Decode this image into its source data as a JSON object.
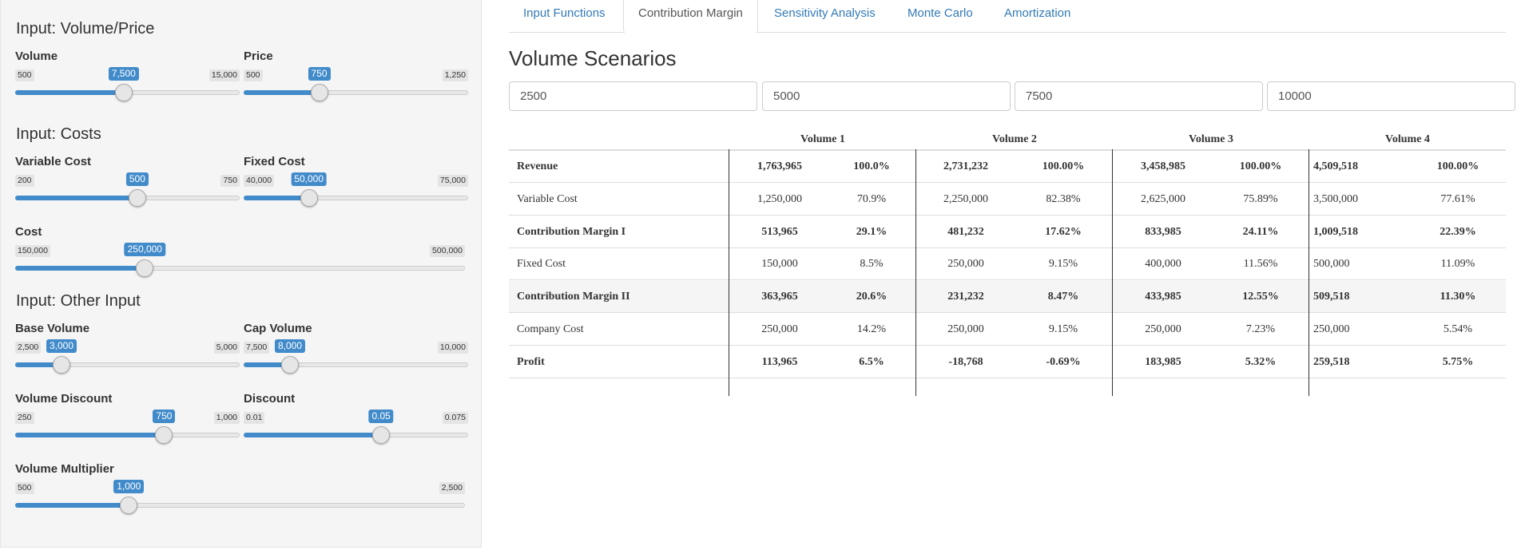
{
  "sidebar": {
    "sections": {
      "volume_price": "Input: Volume/Price",
      "costs": "Input: Costs",
      "other": "Input: Other Input"
    },
    "sliders": {
      "volume": {
        "label": "Volume",
        "min": "500",
        "max": "15,000",
        "value": "7,500",
        "fraction": 0.483
      },
      "price": {
        "label": "Price",
        "min": "500",
        "max": "1,250",
        "value": "750",
        "fraction": 0.333
      },
      "variable_cost": {
        "label": "Variable Cost",
        "min": "200",
        "max": "750",
        "value": "500",
        "fraction": 0.545
      },
      "fixed_cost": {
        "label": "Fixed Cost",
        "min": "40,000",
        "max": "75,000",
        "value": "50,000",
        "fraction": 0.286
      },
      "cost": {
        "label": "Cost",
        "min": "150,000",
        "max": "500,000",
        "value": "250,000",
        "fraction": 0.286
      },
      "base_volume": {
        "label": "Base Volume",
        "min": "2,500",
        "max": "5,000",
        "value": "3,000",
        "fraction": 0.2
      },
      "cap_volume": {
        "label": "Cap Volume",
        "min": "7,500",
        "max": "10,000",
        "value": "8,000",
        "fraction": 0.2
      },
      "volume_discount": {
        "label": "Volume Discount",
        "min": "250",
        "max": "1,000",
        "value": "750",
        "fraction": 0.667
      },
      "discount": {
        "label": "Discount",
        "min": "0.01",
        "max": "0.075",
        "value": "0.05",
        "fraction": 0.615
      },
      "volume_multiplier": {
        "label": "Volume Multiplier",
        "min": "500",
        "max": "2,500",
        "value": "1,000",
        "fraction": 0.25
      }
    }
  },
  "tabs": [
    {
      "label": "Input Functions",
      "active": false
    },
    {
      "label": "Contribution Margin",
      "active": true
    },
    {
      "label": "Sensitivity Analysis",
      "active": false
    },
    {
      "label": "Monte Carlo",
      "active": false
    },
    {
      "label": "Amortization",
      "active": false
    }
  ],
  "main": {
    "title": "Volume Scenarios",
    "scenario_inputs": [
      "2500",
      "5000",
      "7500",
      "10000"
    ],
    "table": {
      "groups": [
        "Volume 1",
        "Volume 2",
        "Volume 3",
        "Volume 4"
      ],
      "rows": [
        {
          "label": "Revenue",
          "bold": true,
          "shaded": false,
          "values": [
            "1,763,965",
            "100.0%",
            "2,731,232",
            "100.00%",
            "3,458,985",
            "100.00%",
            "4,509,518",
            "100.00%"
          ]
        },
        {
          "label": "Variable Cost",
          "bold": false,
          "shaded": false,
          "values": [
            "1,250,000",
            "70.9%",
            "2,250,000",
            "82.38%",
            "2,625,000",
            "75.89%",
            "3,500,000",
            "77.61%"
          ]
        },
        {
          "label": "Contribution Margin I",
          "bold": true,
          "shaded": false,
          "values": [
            "513,965",
            "29.1%",
            "481,232",
            "17.62%",
            "833,985",
            "24.11%",
            "1,009,518",
            "22.39%"
          ]
        },
        {
          "label": "Fixed Cost",
          "bold": false,
          "shaded": false,
          "values": [
            "150,000",
            "8.5%",
            "250,000",
            "9.15%",
            "400,000",
            "11.56%",
            "500,000",
            "11.09%"
          ]
        },
        {
          "label": "Contribution Margin II",
          "bold": true,
          "shaded": true,
          "values": [
            "363,965",
            "20.6%",
            "231,232",
            "8.47%",
            "433,985",
            "12.55%",
            "509,518",
            "11.30%"
          ]
        },
        {
          "label": "Company Cost",
          "bold": false,
          "shaded": false,
          "values": [
            "250,000",
            "14.2%",
            "250,000",
            "9.15%",
            "250,000",
            "7.23%",
            "250,000",
            "5.54%"
          ]
        },
        {
          "label": "Profit",
          "bold": true,
          "shaded": false,
          "values": [
            "113,965",
            "6.5%",
            "-18,768",
            "-0.69%",
            "183,985",
            "5.32%",
            "259,518",
            "5.75%"
          ]
        }
      ]
    }
  }
}
